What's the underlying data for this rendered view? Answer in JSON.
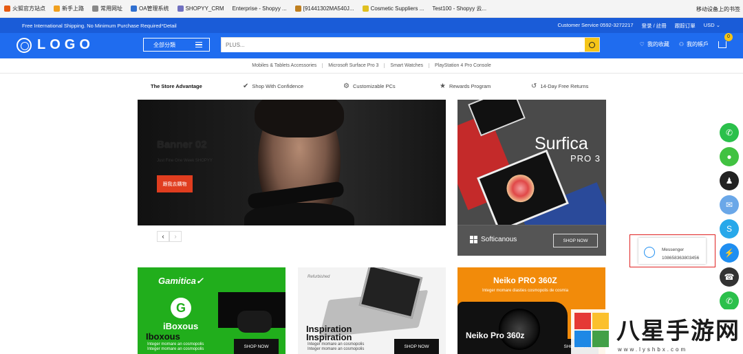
{
  "browser_bookmarks": [
    {
      "label": "火狐官方站点",
      "color": "#e55b13"
    },
    {
      "label": "新手上路",
      "color": "#f0a020"
    },
    {
      "label": "常用网址",
      "color": "#888888"
    },
    {
      "label": "OA管理系统",
      "color": "#3070d0"
    },
    {
      "label": "SHOPYY_CRM",
      "color": "#7070c0"
    },
    {
      "label": "Enterprise - Shopyy ...",
      "color": "#dddddd"
    },
    {
      "label": "[91441302MA540J...",
      "color": "#c08020"
    },
    {
      "label": "Cosmetic Suppliers ...",
      "color": "#e0c020"
    },
    {
      "label": "Test100 - Shopyy 云...",
      "color": "#dddddd"
    }
  ],
  "browser_right": "移动设备上的书签",
  "topbar": {
    "promo": "Free International Shipping. No Minimum Purchase Required*Detail",
    "customer_service": "Customer Service 0592-3272217",
    "login": "登录 / 註冊",
    "orders": "跟踪订單",
    "currency": "USD ⌄"
  },
  "header": {
    "logo_text": "LOGO",
    "category_button": "全部分類",
    "search_placeholder": "PLUS...",
    "favorites": "我的收藏",
    "account": "我的帳戶",
    "cart_count": "0"
  },
  "subnav": [
    "Mobiles & Tablets Accessories",
    "Microsoft Surface Pro 3",
    "Smart Watches",
    "PlayStation 4 Pro Console"
  ],
  "advantages": {
    "title": "The Store Advantage",
    "items": [
      {
        "icon": "✔",
        "label": "Shop With Confidence"
      },
      {
        "icon": "⚙",
        "label": "Customizable PCs"
      },
      {
        "icon": "★",
        "label": "Rewards Program"
      },
      {
        "icon": "↺",
        "label": "14-Day Free Returns"
      }
    ]
  },
  "banner": {
    "title": "Banner 02",
    "subtitle": "Just Fine One Week SHOPYY",
    "button": "跟我去購物",
    "prev": "‹",
    "next": "›"
  },
  "surface_card": {
    "title": "Surfica",
    "subtitle": "PRO 3",
    "brand": "Softicanous",
    "button": "SHOP NOW"
  },
  "cards": [
    {
      "brand": "Gamitica✓",
      "logo": "G",
      "name": "iBoxous",
      "name2": "Iboxous",
      "desc1": "Integer momare an cosmopolis",
      "desc2": "Integer momare an cosmopolis",
      "button": "SHOP NOW"
    },
    {
      "tag": "Refurbished",
      "name": "Inspiration",
      "name2": "Inspiration",
      "desc1": "Integer momare an cosmopolis",
      "desc2": "Integer momare an cosmopolis",
      "button": "SHOP NOW"
    },
    {
      "name": "Neiko PRO 360Z",
      "desc": "Integer momare diasties cosmopolis de cosmia",
      "name2": "Neiko Pro 360z",
      "button": "SHOP NOW"
    }
  ],
  "float_buttons": [
    {
      "name": "whatsapp",
      "color": "#2bc04b",
      "glyph": "✆"
    },
    {
      "name": "wechat",
      "color": "#41c241",
      "glyph": "●"
    },
    {
      "name": "qq",
      "color": "#222222",
      "glyph": "♟"
    },
    {
      "name": "email",
      "color": "#6aa7e8",
      "glyph": "✉"
    },
    {
      "name": "skype",
      "color": "#28a8ea",
      "glyph": "S"
    },
    {
      "name": "messenger",
      "color": "#1f8ef1",
      "glyph": "⚡"
    },
    {
      "name": "phone",
      "color": "#333333",
      "glyph": "☎"
    },
    {
      "name": "line",
      "color": "#2bc04b",
      "glyph": "✆"
    }
  ],
  "messenger_popup": {
    "title": "Messenger",
    "id": "108658363803456"
  },
  "watermark": {
    "text": "八星手游网",
    "url": "www.lyshbx.com"
  }
}
